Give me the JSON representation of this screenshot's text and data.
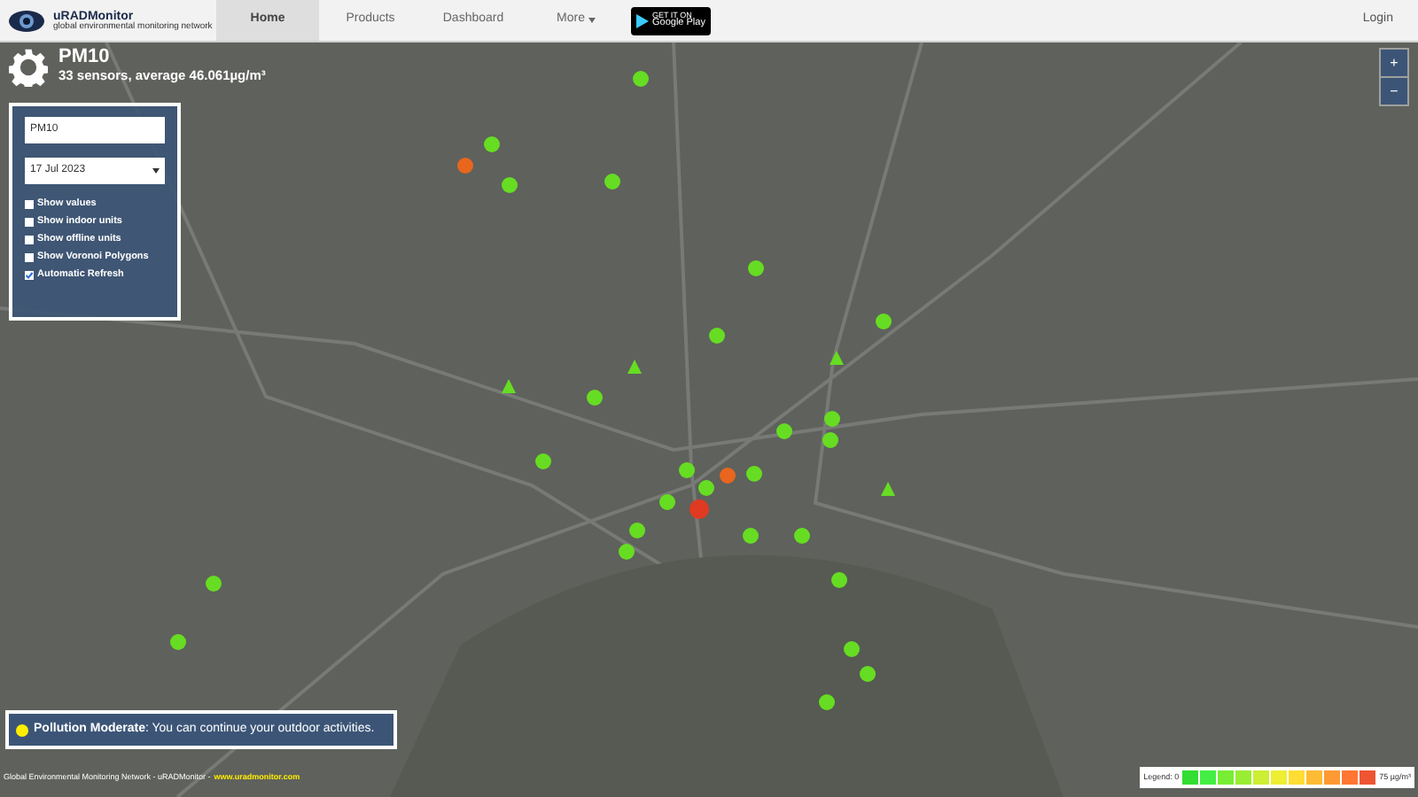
{
  "navbar": {
    "logo": {
      "name": "uRADMonitor",
      "tagline": "global environmental monitoring network"
    },
    "items": [
      {
        "label": "Home",
        "selected": true
      },
      {
        "label": "Products",
        "selected": false
      },
      {
        "label": "Dashboard",
        "selected": false
      },
      {
        "label": "More",
        "selected": false,
        "dropdown": true
      }
    ],
    "store_badge": {
      "top": "GET IT ON",
      "name": "Google Play"
    },
    "login": "Login"
  },
  "header": {
    "title": "PM10",
    "subtitle": "33 sensors, average 46.061µg/m³"
  },
  "controls": {
    "parameter": "PM10",
    "date": "17 Jul 2023",
    "options": [
      {
        "label": "Show values",
        "checked": false
      },
      {
        "label": "Show indoor units",
        "checked": false
      },
      {
        "label": "Show offline units",
        "checked": false
      },
      {
        "label": "Show Voronoi Polygons",
        "checked": false
      },
      {
        "label": "Automatic Refresh",
        "checked": true
      }
    ]
  },
  "zoom": {
    "in": "+",
    "out": "−"
  },
  "sensors": [
    {
      "kind": "circle",
      "color": "#66dd22"
    },
    {
      "kind": "circle",
      "color": "#66dd22"
    },
    {
      "kind": "circle",
      "color": "#66dd22"
    },
    {
      "kind": "circle",
      "color": "#66dd22"
    },
    {
      "kind": "circle",
      "color": "#66dd22"
    },
    {
      "kind": "circle",
      "color": "#66dd22"
    },
    {
      "kind": "circle",
      "color": "#66dd22"
    },
    {
      "kind": "circle",
      "color": "#66dd22"
    },
    {
      "kind": "circle",
      "color": "#66dd22"
    },
    {
      "kind": "circle",
      "color": "#66dd22"
    },
    {
      "kind": "circle",
      "color": "#66dd22"
    },
    {
      "kind": "circle",
      "color": "#66dd22"
    },
    {
      "kind": "circle",
      "color": "#66dd22"
    },
    {
      "kind": "circle",
      "color": "#66dd22"
    },
    {
      "kind": "circle",
      "color": "#66dd22"
    },
    {
      "kind": "circle",
      "color": "#66dd22"
    },
    {
      "kind": "circle",
      "color": "#66dd22"
    },
    {
      "kind": "circle",
      "color": "#66dd22"
    },
    {
      "kind": "circle",
      "color": "#66dd22"
    },
    {
      "kind": "circle",
      "color": "#66dd22"
    },
    {
      "kind": "circle",
      "color": "#66dd22"
    },
    {
      "kind": "circle",
      "color": "#66dd22"
    },
    {
      "kind": "circle",
      "color": "#66dd22"
    },
    {
      "kind": "circle",
      "color": "#66dd22"
    },
    {
      "kind": "circle",
      "color": "#66dd22"
    },
    {
      "kind": "circle",
      "color": "#66dd22"
    },
    {
      "kind": "circle",
      "color": "#e8661e"
    },
    {
      "kind": "circle",
      "color": "#e8661e"
    },
    {
      "kind": "circle",
      "color": "#e03a22"
    },
    {
      "kind": "triangle",
      "color": "#66dd22"
    },
    {
      "kind": "triangle",
      "color": "#66dd22"
    },
    {
      "kind": "triangle",
      "color": "#66dd22"
    },
    {
      "kind": "triangle",
      "color": "#66dd22"
    }
  ],
  "alert": {
    "color": "#ffee00",
    "text": "**Pollution Moderate**: You can continue your outdoor activities."
  },
  "footer": {
    "text": "Global Environmental Monitoring Network - uRADMonitor -",
    "link": "www.uradmonitor.com"
  },
  "legend": {
    "label": "Legend: 0",
    "max": "75 µg/m³",
    "colors": [
      {
        "color": "#33dd33"
      },
      {
        "color": "#44ee44"
      },
      {
        "color": "#77ee33"
      },
      {
        "color": "#99ee33"
      },
      {
        "color": "#ccee33"
      },
      {
        "color": "#eeee33"
      },
      {
        "color": "#ffdd33"
      },
      {
        "color": "#ffbb33"
      },
      {
        "color": "#ff9933"
      },
      {
        "color": "#ff7733"
      },
      {
        "color": "#ee5533"
      }
    ]
  }
}
